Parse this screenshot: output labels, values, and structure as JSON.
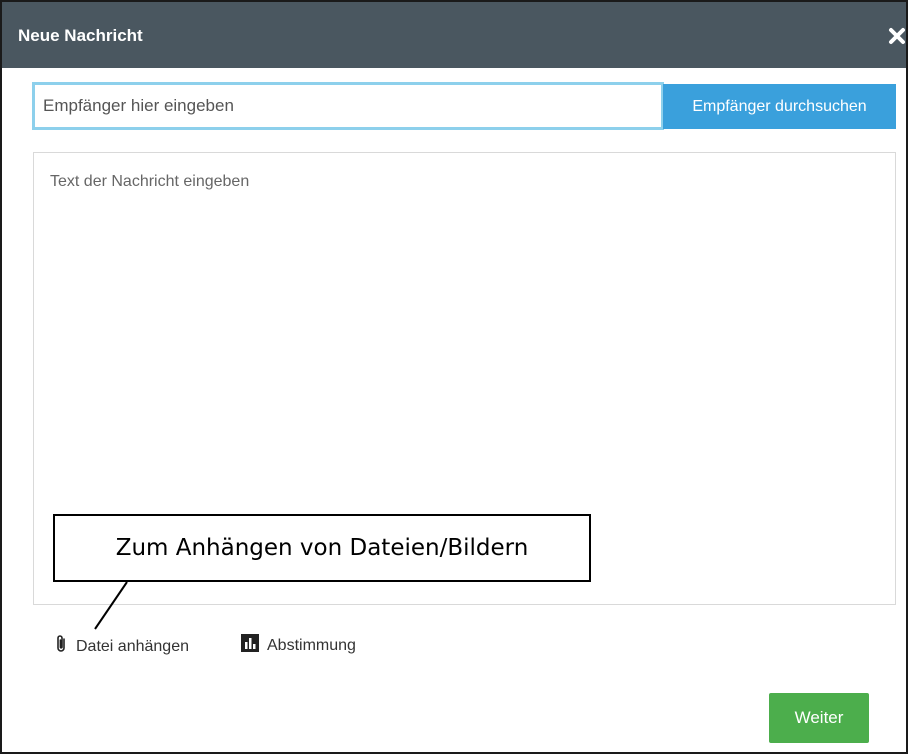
{
  "dialog": {
    "title": "Neue Nachricht",
    "close_icon": "close-icon"
  },
  "recipient": {
    "placeholder": "Empfänger hier eingeben",
    "value": "",
    "search_label": "Empfänger durchsuchen"
  },
  "message": {
    "placeholder": "Text der Nachricht eingeben"
  },
  "annotation": {
    "text": "Zum Anhängen von Dateien/Bildern"
  },
  "toolbar": {
    "attach_label": "Datei anhängen",
    "attach_icon": "paperclip-icon",
    "poll_label": "Abstimmung",
    "poll_icon": "bar-chart-icon"
  },
  "footer": {
    "next_label": "Weiter"
  },
  "colors": {
    "titlebar": "#4a5760",
    "accent_blue": "#3aa0dc",
    "focus_border": "#8dd0ec",
    "next_green": "#4cae4c"
  }
}
